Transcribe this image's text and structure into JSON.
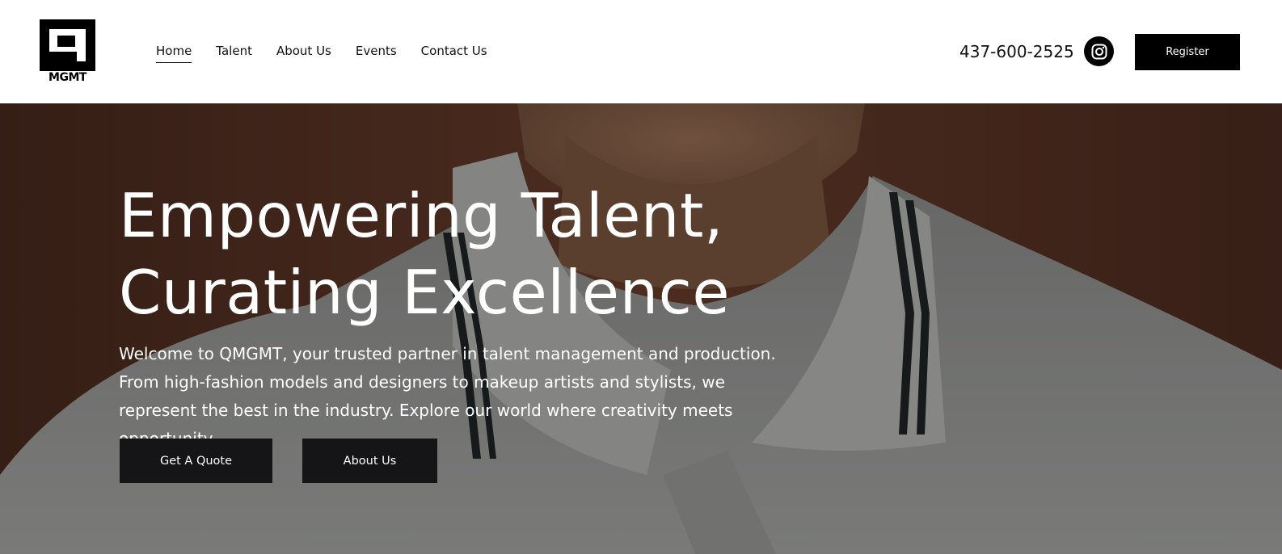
{
  "brand": {
    "logo_text": "MGMT"
  },
  "nav": {
    "items": [
      {
        "label": "Home",
        "active": true
      },
      {
        "label": "Talent",
        "active": false
      },
      {
        "label": "About Us",
        "active": false
      },
      {
        "label": "Events",
        "active": false
      },
      {
        "label": "Contact Us",
        "active": false
      }
    ]
  },
  "header": {
    "phone": "437-600-2525",
    "instagram_icon": "instagram-icon",
    "register_label": "Register"
  },
  "hero": {
    "title_line1": "Empowering Talent,",
    "title_line2": "Curating Excellence",
    "description": "Welcome to QMGMT, your trusted partner in talent management and production. From high-fashion models and designers to makeup artists and stylists, we represent the best in the industry. Explore our world where creativity meets opportunity",
    "primary_button": "Get A Quote",
    "secondary_button": "About Us"
  },
  "colors": {
    "header_bg": "#ffffff",
    "button_bg": "#151517",
    "hero_bg": "#5b3a2c",
    "text_dark": "#111111"
  }
}
